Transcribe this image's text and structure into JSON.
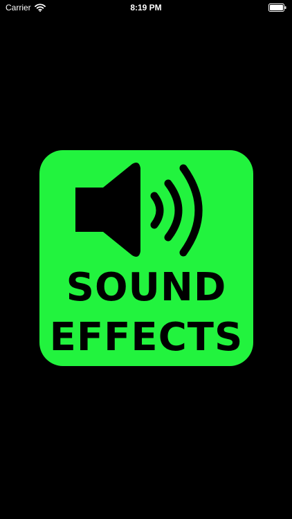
{
  "status_bar": {
    "carrier": "Carrier",
    "time": "8:19 PM",
    "icons": [
      "wifi-icon",
      "battery-icon"
    ]
  },
  "logo": {
    "line1": "SOUND",
    "line2": "EFFECTS",
    "icon": "speaker-icon",
    "colors": {
      "tile": "#22f33e",
      "foreground": "#000000",
      "background": "#000000"
    }
  }
}
